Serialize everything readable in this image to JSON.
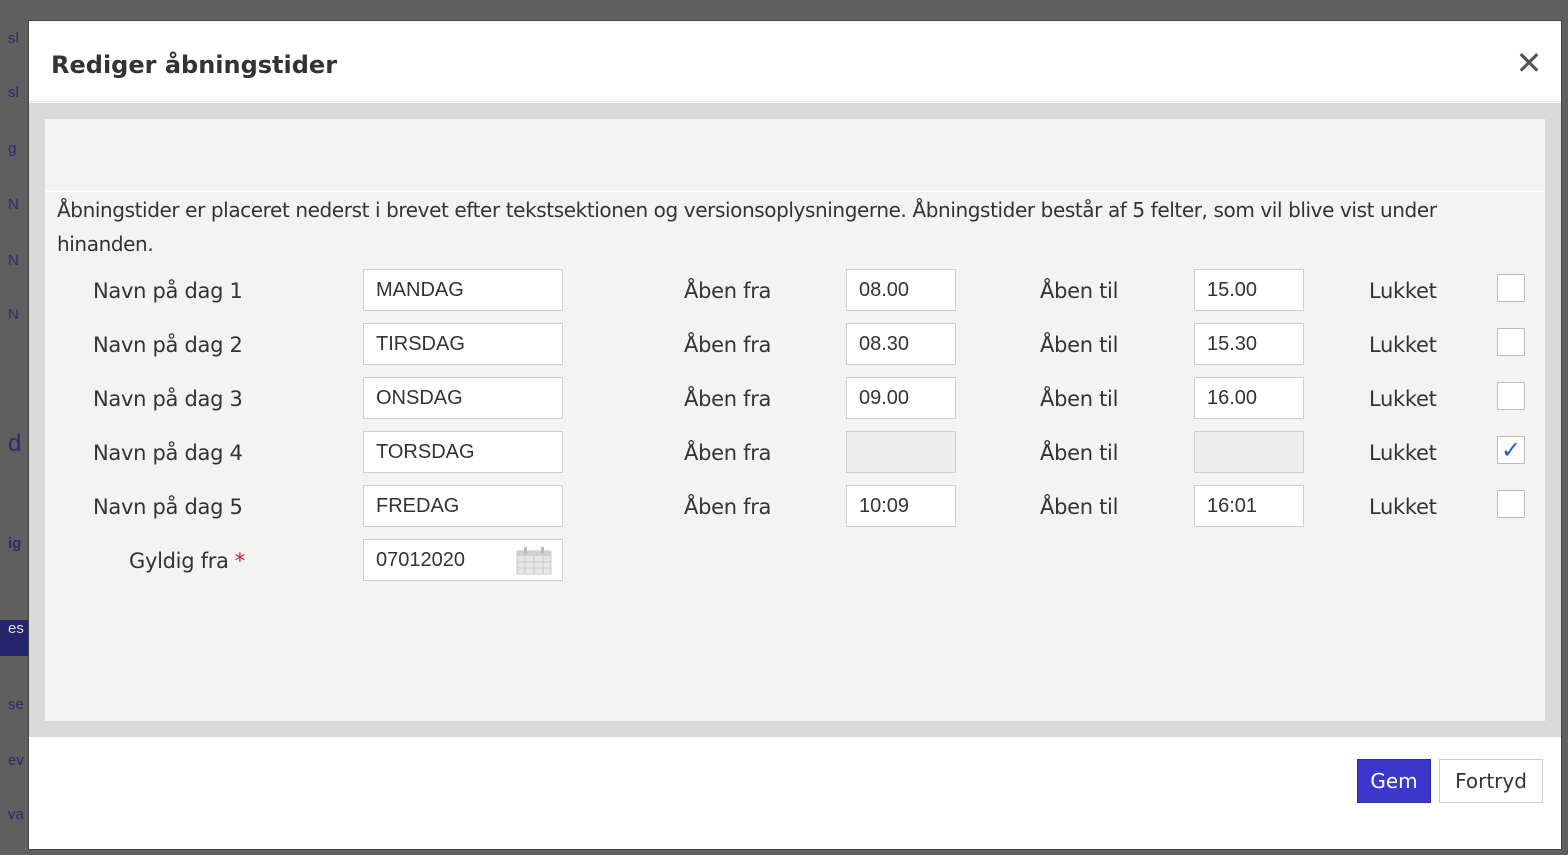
{
  "background": {
    "fragments": [
      "sl",
      "sl",
      "g",
      "N",
      "N",
      "N",
      "d",
      "ig",
      "es",
      "se",
      "ev",
      "va"
    ],
    "overlay_color": "#5f5f5f"
  },
  "dialog": {
    "title": "Rediger åbningstider",
    "close_icon": "close-icon",
    "description": "Åbningstider er placeret nederst i brevet efter tekstsektionen og versionsoplysningerne. Åbningstider består af 5 felter, som vil blive vist under hinanden.",
    "labels": {
      "from": "Åben fra",
      "to": "Åben til",
      "closed": "Lukket"
    },
    "days": [
      {
        "label": "Navn på dag 1",
        "name": "MANDAG",
        "from": "08.00",
        "to": "15.00",
        "closed": false,
        "check": ""
      },
      {
        "label": "Navn på dag 2",
        "name": "TIRSDAG",
        "from": "08.30",
        "to": "15.30",
        "closed": false,
        "check": ""
      },
      {
        "label": "Navn på dag 3",
        "name": "ONSDAG",
        "from": "09.00",
        "to": "16.00",
        "closed": false,
        "check": ""
      },
      {
        "label": "Navn på dag 4",
        "name": "TORSDAG",
        "from": "",
        "to": "",
        "closed": true,
        "check": "✓"
      },
      {
        "label": "Navn på dag 5",
        "name": "FREDAG",
        "from": "10:09",
        "to": "16:01",
        "closed": false,
        "check": ""
      }
    ],
    "valid_from": {
      "label": "Gyldig fra",
      "required_mark": "*",
      "value": "07012020",
      "icon": "calendar-icon"
    },
    "buttons": {
      "save": "Gem",
      "cancel": "Fortryd"
    },
    "colors": {
      "primary": "#3b36cc",
      "required": "#cc2222",
      "check": "#2b5fd6"
    }
  }
}
